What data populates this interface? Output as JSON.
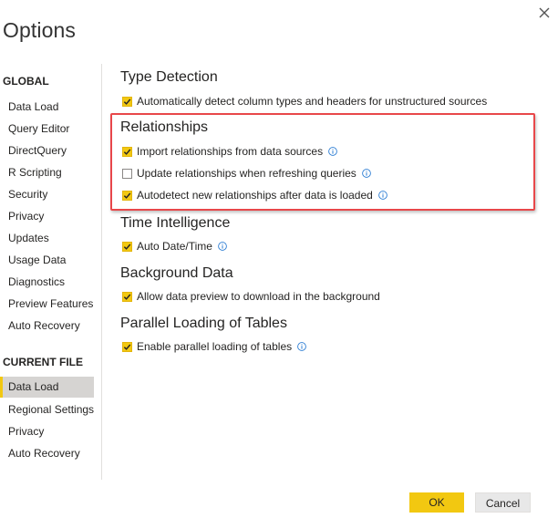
{
  "dialog": {
    "title": "Options"
  },
  "sidebar": {
    "global_heading": "GLOBAL",
    "global_items": [
      {
        "label": "Data Load"
      },
      {
        "label": "Query Editor"
      },
      {
        "label": "DirectQuery"
      },
      {
        "label": "R Scripting"
      },
      {
        "label": "Security"
      },
      {
        "label": "Privacy"
      },
      {
        "label": "Updates"
      },
      {
        "label": "Usage Data"
      },
      {
        "label": "Diagnostics"
      },
      {
        "label": "Preview Features"
      },
      {
        "label": "Auto Recovery"
      }
    ],
    "current_file_heading": "CURRENT FILE",
    "current_file_items": [
      {
        "label": "Data Load",
        "selected": true
      },
      {
        "label": "Regional Settings"
      },
      {
        "label": "Privacy"
      },
      {
        "label": "Auto Recovery"
      }
    ]
  },
  "main": {
    "groups": [
      {
        "title": "Type Detection",
        "options": [
          {
            "label": "Automatically detect column types and headers for unstructured sources",
            "checked": true,
            "info": false
          }
        ]
      },
      {
        "title": "Relationships",
        "options": [
          {
            "label": "Import relationships from data sources",
            "checked": true,
            "info": true
          },
          {
            "label": "Update relationships when refreshing queries",
            "checked": false,
            "info": true
          },
          {
            "label": "Autodetect new relationships after data is loaded",
            "checked": true,
            "info": true
          }
        ]
      },
      {
        "title": "Time Intelligence",
        "options": [
          {
            "label": "Auto Date/Time",
            "checked": true,
            "info": true
          }
        ]
      },
      {
        "title": "Background Data",
        "options": [
          {
            "label": "Allow data preview to download in the background",
            "checked": true,
            "info": false
          }
        ]
      },
      {
        "title": "Parallel Loading of Tables",
        "options": [
          {
            "label": "Enable parallel loading of tables",
            "checked": true,
            "info": true
          }
        ]
      }
    ]
  },
  "footer": {
    "ok_label": "OK",
    "cancel_label": "Cancel"
  },
  "colors": {
    "accent": "#f2c811",
    "highlight": "#e8474a",
    "info": "#2b7cd3",
    "selected_bg": "#d6d4d2"
  }
}
